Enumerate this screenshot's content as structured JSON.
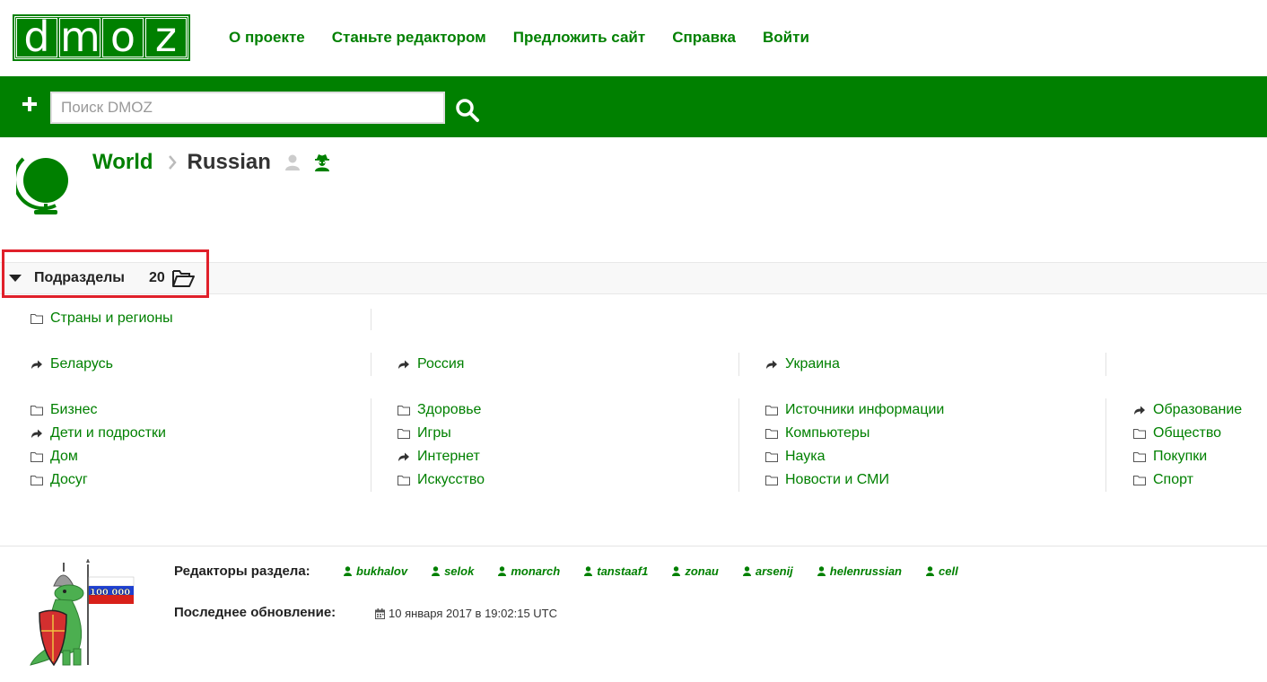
{
  "logo": {
    "letters": [
      "d",
      "m",
      "o",
      "z"
    ]
  },
  "nav": {
    "about": "О проекте",
    "become_editor": "Станьте редактором",
    "suggest_site": "Предложить сайт",
    "help": "Справка",
    "login": "Войти"
  },
  "search": {
    "placeholder": "Поиск DMOZ",
    "value": ""
  },
  "breadcrumb": {
    "world": "World",
    "current": "Russian"
  },
  "subcategories": {
    "title": "Подразделы",
    "count": "20"
  },
  "categories": {
    "row1": [
      {
        "label": "Страны и регионы",
        "icon": "folder-icon"
      }
    ],
    "row2": [
      {
        "label": "Беларусь",
        "icon": "share-icon"
      },
      {
        "label": "Россия",
        "icon": "share-icon"
      },
      {
        "label": "Украина",
        "icon": "share-icon"
      }
    ],
    "col1": [
      {
        "label": "Бизнес",
        "icon": "folder-icon"
      },
      {
        "label": "Дети и подростки",
        "icon": "share-icon"
      },
      {
        "label": "Дом",
        "icon": "folder-icon"
      },
      {
        "label": "Досуг",
        "icon": "folder-icon"
      }
    ],
    "col2": [
      {
        "label": "Здоровье",
        "icon": "folder-icon"
      },
      {
        "label": "Игры",
        "icon": "folder-icon"
      },
      {
        "label": "Интернет",
        "icon": "share-icon"
      },
      {
        "label": "Искусство",
        "icon": "folder-icon"
      }
    ],
    "col3": [
      {
        "label": "Источники информации",
        "icon": "folder-icon"
      },
      {
        "label": "Компьютеры",
        "icon": "folder-icon"
      },
      {
        "label": "Наука",
        "icon": "folder-icon"
      },
      {
        "label": "Новости и СМИ",
        "icon": "folder-icon"
      }
    ],
    "col4": [
      {
        "label": "Образование",
        "icon": "share-icon"
      },
      {
        "label": "Общество",
        "icon": "folder-icon"
      },
      {
        "label": "Покупки",
        "icon": "folder-icon"
      },
      {
        "label": "Спорт",
        "icon": "folder-icon"
      }
    ]
  },
  "footer": {
    "editors_label": "Редакторы раздела:",
    "editors": [
      "bukhalov",
      "selok",
      "monarch",
      "tanstaaf1",
      "zonau",
      "arsenij",
      "helenrussian",
      "cell"
    ],
    "update_label": "Последнее обновление:",
    "update_value": "10 января 2017 в 19:02:15 UTC",
    "mascot_flag_text": "100 000"
  },
  "colors": {
    "brand_green": "#008000",
    "highlight_red": "#e0202a"
  }
}
